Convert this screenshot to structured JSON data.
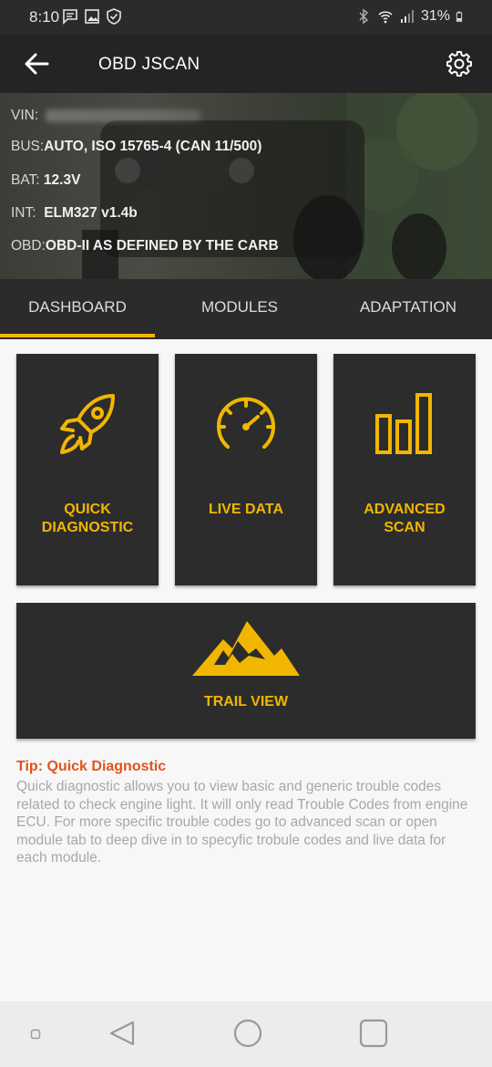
{
  "status_bar": {
    "time": "8:10",
    "battery": "31%",
    "left_icons": [
      "message-icon",
      "image-icon",
      "shield-check-icon"
    ],
    "right_icons": [
      "bluetooth-icon",
      "wifi-icon",
      "signal-icon",
      "battery-icon"
    ]
  },
  "app_bar": {
    "title": "OBD JSCAN",
    "back_icon": "back-arrow-icon",
    "settings_icon": "gear-icon"
  },
  "vehicle_info": {
    "vin_label": "VIN:",
    "bus_label": "BUS:",
    "bus_value": "AUTO, ISO 15765-4 (CAN 11/500)",
    "bat_label": "BAT:",
    "bat_value": "12.3V",
    "int_label": "INT:",
    "int_value": "ELM327 v1.4b",
    "obd_label": "OBD:",
    "obd_value": "OBD-II AS DEFINED BY THE CARB"
  },
  "tabs": [
    {
      "label": "DASHBOARD",
      "active": true
    },
    {
      "label": "MODULES",
      "active": false
    },
    {
      "label": "ADAPTATION",
      "active": false
    }
  ],
  "tiles": {
    "quick_diagnostic": {
      "line1": "QUICK",
      "line2": "DIAGNOSTIC",
      "icon": "rocket-icon"
    },
    "live_data": {
      "line1": "LIVE DATA",
      "icon": "speedometer-icon"
    },
    "advanced_scan": {
      "line1": "ADVANCED",
      "line2": "SCAN",
      "icon": "bar-chart-icon"
    },
    "trail_view": {
      "line1": "TRAIL VIEW",
      "icon": "mountain-icon"
    }
  },
  "tip": {
    "title": "Tip: Quick Diagnostic",
    "body": "Quick diagnostic allows you to view basic and generic trouble codes related to check engine light. It will only read Trouble Codes from engine ECU. For more specific trouble codes go to advanced scan or open module tab to deep dive in to specyfic trobule codes and live data for each module."
  },
  "colors": {
    "accent": "#f1b600",
    "tip_title": "#e0541c",
    "tile_bg": "#2c2c2c",
    "app_bar": "#242424"
  },
  "nav_bar": {
    "icons": [
      "menu-dot-icon",
      "back-triangle-icon",
      "home-circle-icon",
      "recents-square-icon"
    ]
  }
}
